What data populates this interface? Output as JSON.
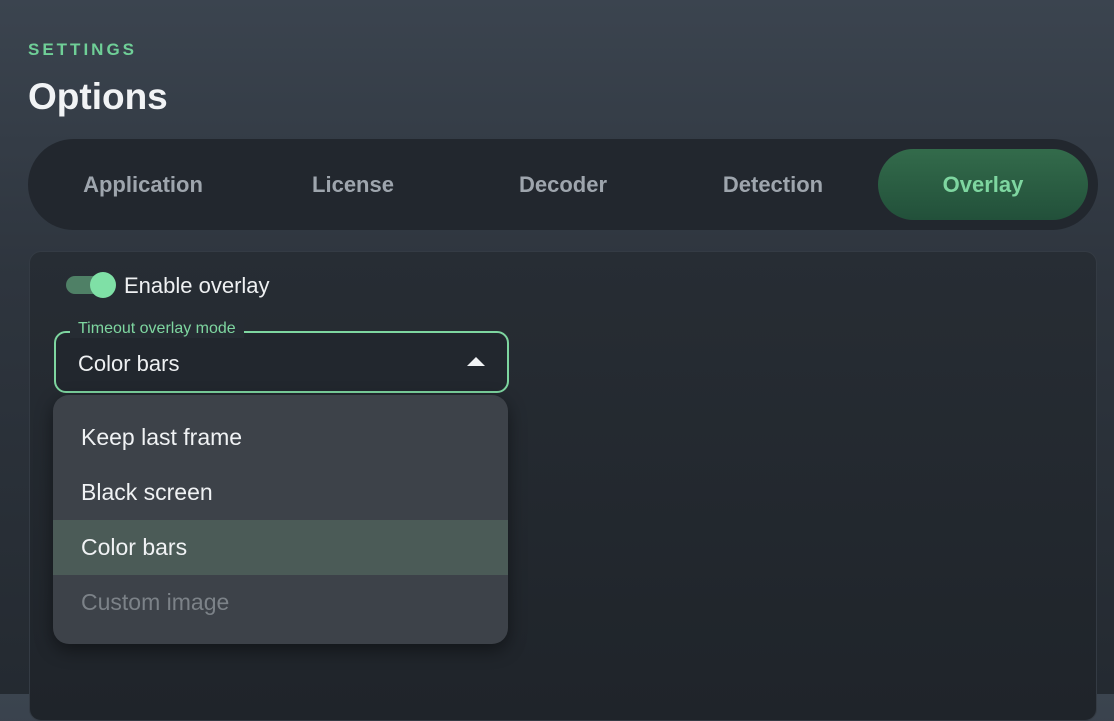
{
  "header": {
    "eyebrow": "SETTINGS",
    "title": "Options"
  },
  "tabs": [
    {
      "label": "Application",
      "active": false
    },
    {
      "label": "License",
      "active": false
    },
    {
      "label": "Decoder",
      "active": false
    },
    {
      "label": "Detection",
      "active": false
    },
    {
      "label": "Overlay",
      "active": true
    }
  ],
  "overlay": {
    "enable_toggle": {
      "label": "Enable overlay",
      "checked": true
    },
    "timeout_mode": {
      "label": "Timeout overlay mode",
      "value": "Color bars",
      "expanded": true,
      "options": [
        {
          "label": "Keep last frame",
          "state": "normal"
        },
        {
          "label": "Black screen",
          "state": "normal"
        },
        {
          "label": "Color bars",
          "state": "selected"
        },
        {
          "label": "Custom image",
          "state": "disabled"
        }
      ]
    }
  },
  "colors": {
    "accent": "#7ed6a0",
    "active_tab_bg": "#2b5e42",
    "background": "#2e353e"
  },
  "icons": {
    "select_caret": "caret-up-icon"
  }
}
